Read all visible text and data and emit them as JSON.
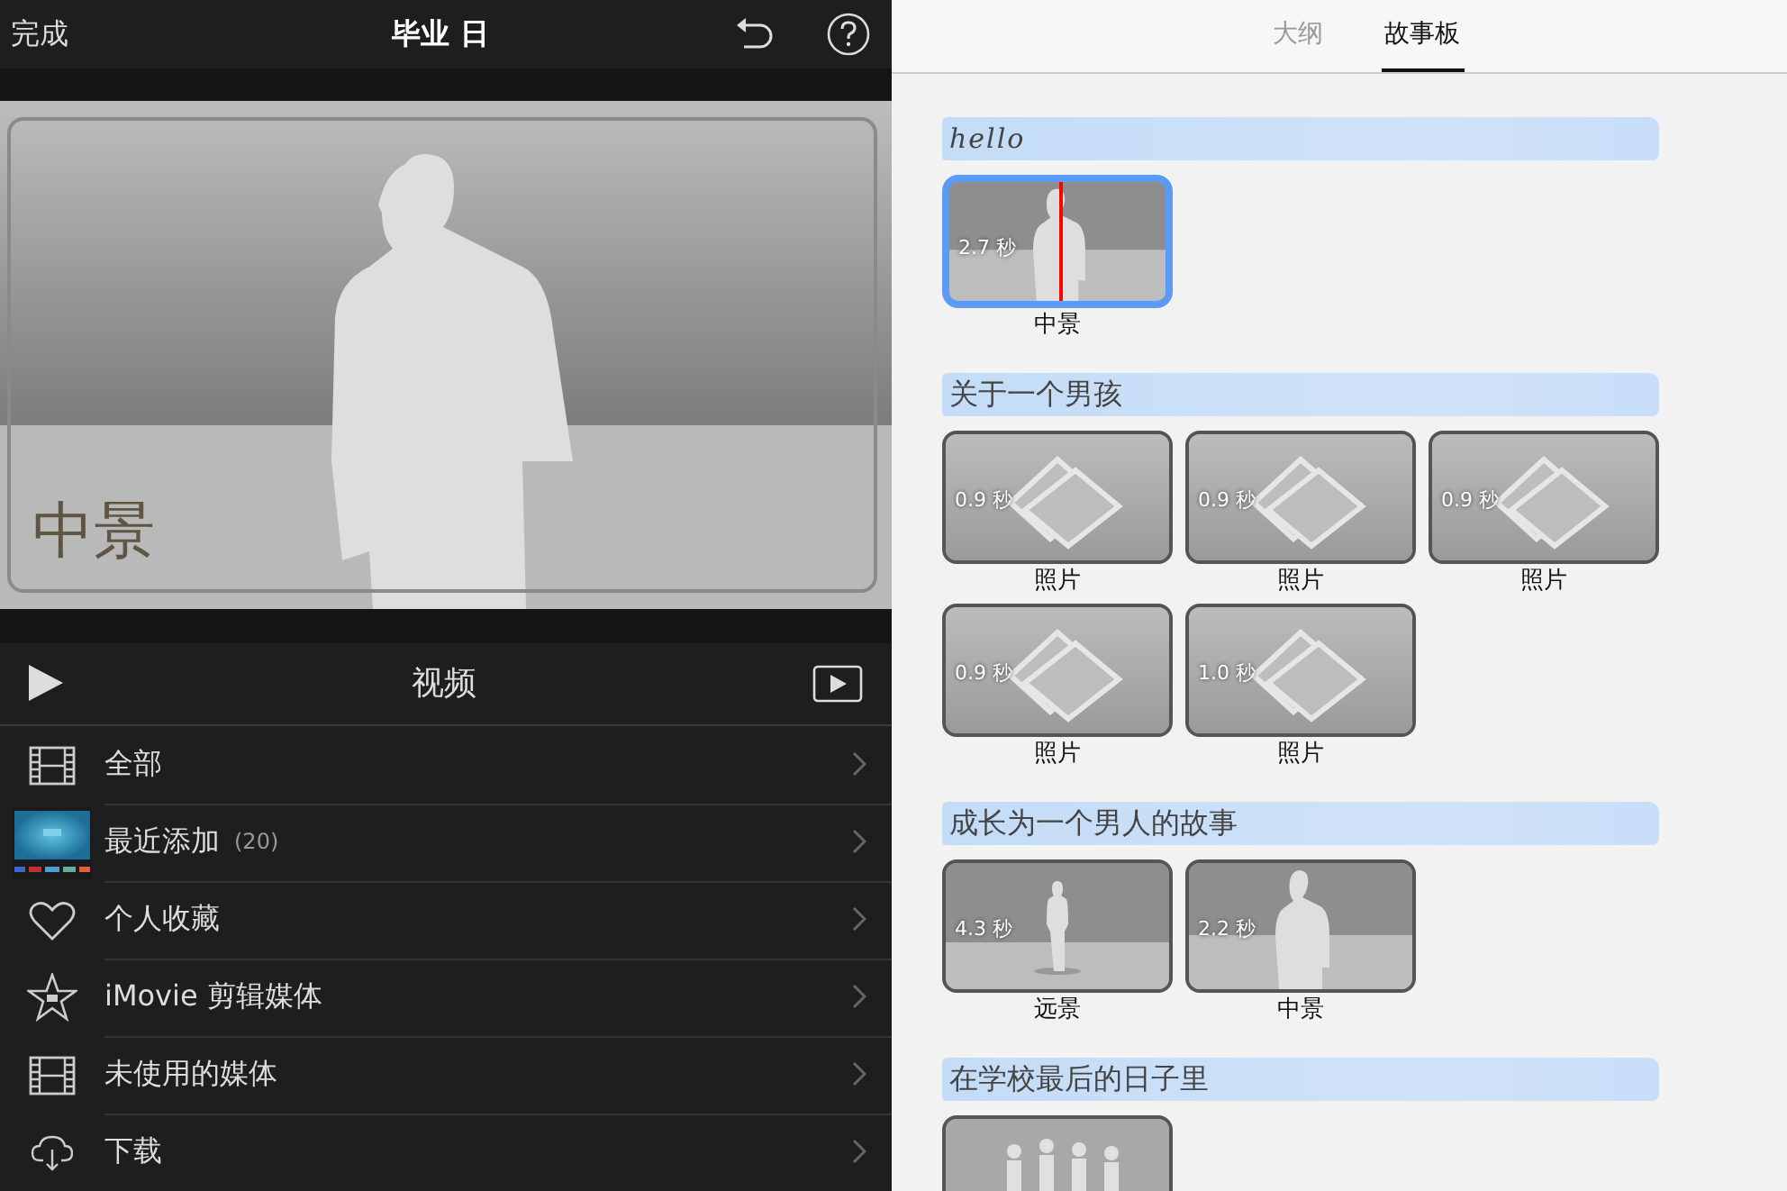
{
  "toolbar": {
    "done": "完成",
    "title": "毕业 日"
  },
  "preview": {
    "caption": "中景"
  },
  "media": {
    "title": "视频",
    "items": [
      {
        "kind": "film",
        "label": "全部"
      },
      {
        "kind": "thumbnail",
        "label": "最近添加",
        "count": "(20)"
      },
      {
        "kind": "heart",
        "label": "个人收藏"
      },
      {
        "kind": "star",
        "label": "iMovie 剪辑媒体"
      },
      {
        "kind": "film",
        "label": "未使用的媒体"
      },
      {
        "kind": "cloud",
        "label": "下载"
      }
    ]
  },
  "tabs": [
    {
      "label": "大纲",
      "selected": false
    },
    {
      "label": "故事板",
      "selected": true
    }
  ],
  "sections": [
    {
      "title": "hello",
      "kind": "script",
      "clips": [
        {
          "kind": "medium",
          "duration": "2.7 秒",
          "label": "中景",
          "selected": true
        }
      ]
    },
    {
      "title": "关于一个男孩",
      "kind": "plain",
      "clips": [
        {
          "duration": "0.9 秒",
          "label": "照片",
          "selected": false
        },
        {
          "duration": "0.9 秒",
          "label": "照片",
          "selected": false
        },
        {
          "duration": "0.9 秒",
          "label": "照片",
          "selected": false
        },
        {
          "duration": "0.9 秒",
          "label": "照片",
          "selected": false
        },
        {
          "duration": "1.0 秒",
          "label": "照片",
          "selected": false
        }
      ]
    },
    {
      "title": "成长为一个男人的故事",
      "kind": "plain",
      "clips": [
        {
          "kind": "wide",
          "duration": "4.3 秒",
          "label": "远景",
          "selected": false
        },
        {
          "kind": "medium",
          "duration": "2.2 秒",
          "label": "中景",
          "selected": false
        }
      ]
    },
    {
      "title": "在学校最后的日子里",
      "kind": "plain",
      "clips": [
        {
          "kind": "group",
          "selected": false
        }
      ]
    }
  ]
}
